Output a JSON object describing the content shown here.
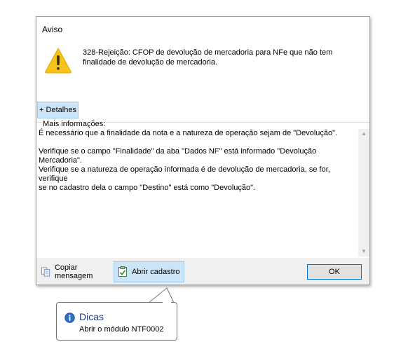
{
  "dialog": {
    "title": "Aviso",
    "icon": "warning-icon",
    "message": "328-Rejeição: CFOP de devolução de mercadoria para NFe que não tem finalidade de devolução de mercadoria.",
    "details_button": "+ Detalhes",
    "more_info_label": "Mais informações:",
    "more_info_lines": [
      "É necessário que a finalidade da nota e a natureza de operação sejam de \"Devolução\".",
      "",
      "Verifique se o campo \"Finalidade\" da aba \"Dados NF\" está informado \"Devolução Mercadoria\".",
      "Verifique se a natureza de operação informada é de devolução de mercadoria, se for, verifique",
      "se no cadastro dela o campo \"Destino\" está como \"Devolução\"."
    ],
    "copy_button": "Copiar mensagem",
    "open_register_button": "Abrir cadastro",
    "ok_button": "OK"
  },
  "tooltip": {
    "title": "Dicas",
    "text": "Abrir o módulo NTF0002",
    "icon": "info-icon"
  },
  "colors": {
    "accent_bg": "#cce4f7",
    "accent_border": "#99c9ef",
    "ok_border": "#0078d7",
    "warning_yellow": "#f7c21a",
    "tip_title": "#1f3b86"
  }
}
